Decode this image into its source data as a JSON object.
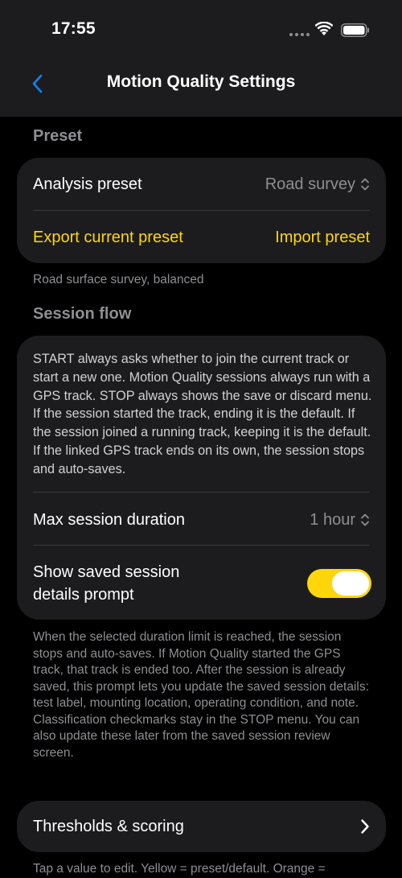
{
  "status_bar": {
    "time": "17:55"
  },
  "nav": {
    "title": "Motion Quality Settings",
    "back_icon": "chevron-left-icon"
  },
  "preset_section": {
    "header": "Preset",
    "analysis_label": "Analysis preset",
    "analysis_value": "Road survey",
    "export_label": "Export current preset",
    "import_label": "Import preset",
    "footer": "Road surface survey, balanced"
  },
  "session_flow_section": {
    "header": "Session flow",
    "description": "START always asks whether to join the current track or start a new one. Motion Quality sessions always run with a GPS track. STOP always shows the save or discard menu. If the session started the track, ending it is the default. If the session joined a running track, keeping it is the default. If the linked GPS track ends on its own, the session stops and auto-saves.",
    "max_duration_label": "Max session duration",
    "max_duration_value": "1 hour",
    "show_prompt_label_line1": "Show saved session",
    "show_prompt_label_line2": "details prompt",
    "show_prompt_enabled": true,
    "footer": "When the selected duration limit is reached, the session stops and auto-saves. If Motion Quality started the GPS track, that track is ended too. After the session is already saved, this prompt lets you update the saved session details: test label, mounting location, operating condition, and note. Classification checkmarks stay in the STOP menu. You can also update these later from the saved session review screen."
  },
  "thresholds_section": {
    "label": "Thresholds & scoring",
    "footer": "Tap a value to edit. Yellow = preset/default. Orange ="
  },
  "colors": {
    "accent_yellow": "#ffd60a",
    "back_blue": "#0a84ff",
    "background": "#000000",
    "card": "#1c1c1e",
    "secondary_text": "#8e8e93"
  }
}
